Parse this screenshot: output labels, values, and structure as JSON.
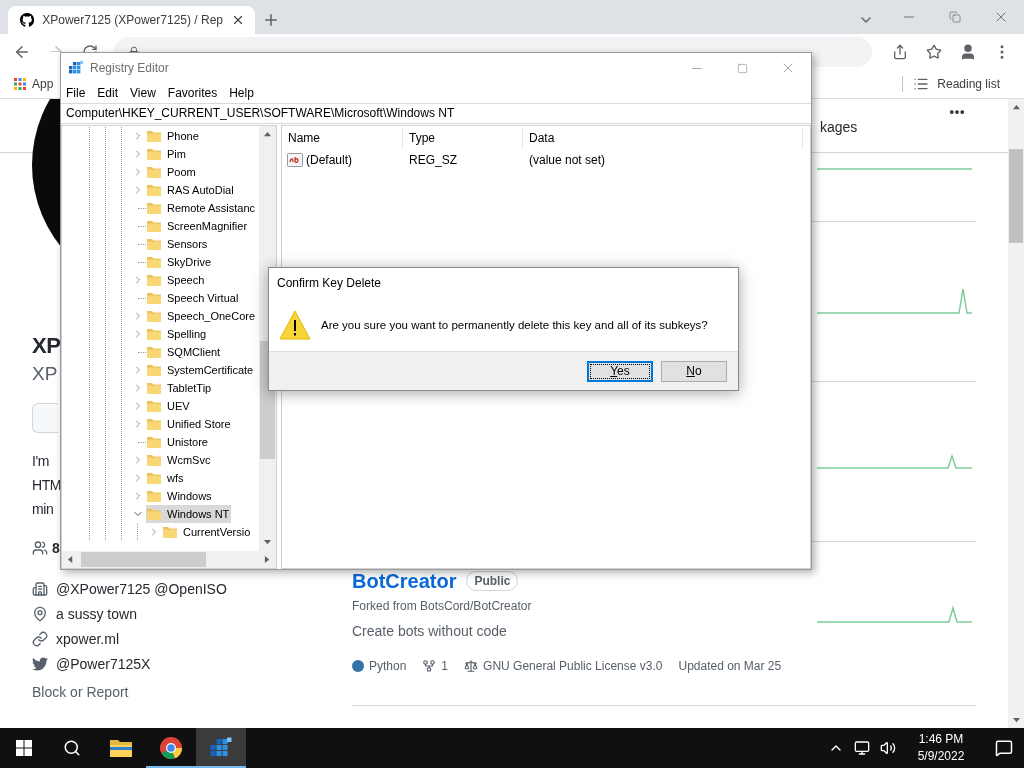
{
  "browser": {
    "tabs": [
      {
        "title": "XPower7125 (XPower7125) / Rep",
        "selected": true
      }
    ],
    "bookmarks": [
      {
        "label": "App"
      }
    ],
    "reading_list": "Reading list"
  },
  "nav": {
    "tabs": [
      {
        "label": "kages"
      }
    ]
  },
  "profile": {
    "name": "XP",
    "username": "XP",
    "bio": [
      "I'm",
      "HTM",
      "min"
    ],
    "followers": "8",
    "details": [
      {
        "kind": "organization",
        "text": "@XPower7125 @OpenISO"
      },
      {
        "kind": "location",
        "text": "a sussy town"
      },
      {
        "kind": "link",
        "text": "xpower.ml"
      },
      {
        "kind": "twitter",
        "text": "@Power7125X"
      }
    ],
    "block_report": "Block or Report"
  },
  "repositories": [
    {
      "kind": "cut"
    },
    {
      "kind": "covered"
    },
    {
      "kind": "covered"
    },
    {
      "kind": "card",
      "name": "BotCreator",
      "visibility": "Public",
      "forked_from": "Forked from BotsCord/BotCreator",
      "description": "Create bots without code",
      "language": "Python",
      "color": "#3572a5",
      "forks": "1",
      "license": "GNU General Public License v3.0",
      "updated": "Updated on Mar 25"
    }
  ],
  "registry_editor": {
    "title": "Registry Editor",
    "menu": [
      "File",
      "Edit",
      "View",
      "Favorites",
      "Help"
    ],
    "address": "Computer\\HKEY_CURRENT_USER\\SOFTWARE\\Microsoft\\Windows NT",
    "tree": [
      {
        "label": "Phone",
        "kind": "branch",
        "expanded": false,
        "selected": false
      },
      {
        "label": "Pim",
        "kind": "branch",
        "expanded": false,
        "selected": false
      },
      {
        "label": "Poom",
        "kind": "branch",
        "expanded": false,
        "selected": false
      },
      {
        "label": "RAS AutoDial",
        "kind": "branch",
        "expanded": false,
        "selected": false
      },
      {
        "label": "Remote Assistanc",
        "kind": "leaf",
        "selected": false
      },
      {
        "label": "ScreenMagnifier",
        "kind": "leaf",
        "selected": false
      },
      {
        "label": "Sensors",
        "kind": "leaf",
        "selected": false
      },
      {
        "label": "SkyDrive",
        "kind": "leaf",
        "selected": false
      },
      {
        "label": "Speech",
        "kind": "branch",
        "expanded": false,
        "selected": false
      },
      {
        "label": "Speech Virtual",
        "kind": "leaf",
        "selected": false
      },
      {
        "label": "Speech_OneCore",
        "kind": "branch",
        "expanded": false,
        "selected": false
      },
      {
        "label": "Spelling",
        "kind": "branch",
        "expanded": false,
        "selected": false
      },
      {
        "label": "SQMClient",
        "kind": "leaf",
        "selected": false
      },
      {
        "label": "SystemCertificate",
        "kind": "branch",
        "expanded": false,
        "selected": false
      },
      {
        "label": "TabletTip",
        "kind": "branch",
        "expanded": false,
        "selected": false
      },
      {
        "label": "UEV",
        "kind": "branch",
        "expanded": false,
        "selected": false
      },
      {
        "label": "Unified Store",
        "kind": "branch",
        "expanded": false,
        "selected": false
      },
      {
        "label": "Unistore",
        "kind": "leaf",
        "selected": false
      },
      {
        "label": "WcmSvc",
        "kind": "branch",
        "expanded": false,
        "selected": false
      },
      {
        "label": "wfs",
        "kind": "branch",
        "expanded": false,
        "selected": false
      },
      {
        "label": "Windows",
        "kind": "branch",
        "expanded": false,
        "selected": false
      },
      {
        "label": "Windows NT",
        "kind": "branch",
        "expanded": true,
        "selected": true,
        "children": [
          {
            "label": "CurrentVersio",
            "kind": "branch",
            "expanded": false,
            "selected": false
          }
        ]
      }
    ],
    "columns": [
      "Name",
      "Type",
      "Data"
    ],
    "values": [
      {
        "name": "(Default)",
        "type": "REG_SZ",
        "data": "(value not set)"
      }
    ]
  },
  "dialog": {
    "title": "Confirm Key Delete",
    "message": "Are you sure you want to permanently delete this key and all of its subkeys?",
    "buttons": [
      {
        "label": "Yes",
        "focused": true
      },
      {
        "label": "No",
        "focused": false
      }
    ]
  },
  "taskbar": {
    "apps": [
      {
        "kind": "explorer",
        "running": false,
        "active": false
      },
      {
        "kind": "browser",
        "running": true,
        "active": false
      },
      {
        "kind": "registry",
        "running": true,
        "active": true
      }
    ],
    "time": "1:46 PM",
    "date": "5/9/2022"
  }
}
